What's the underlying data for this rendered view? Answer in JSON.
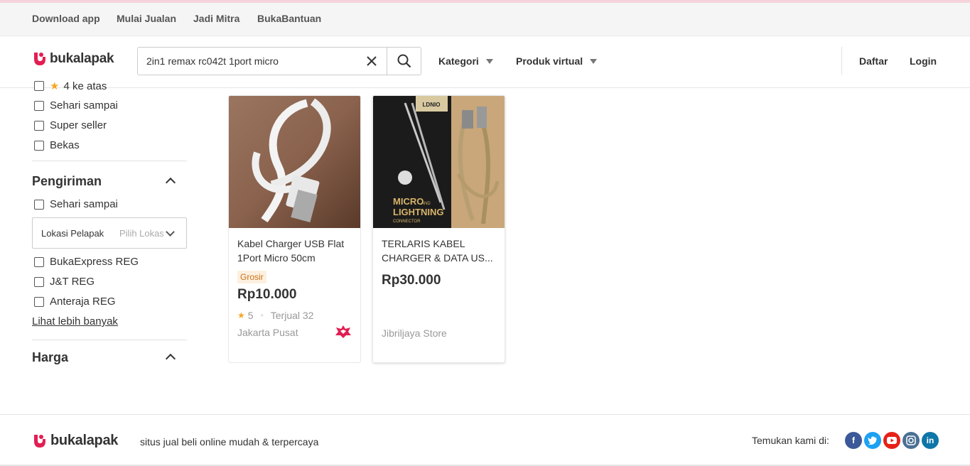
{
  "topbar": {
    "links": [
      "Download app",
      "Mulai Jualan",
      "Jadi Mitra",
      "BukaBantuan"
    ]
  },
  "header": {
    "logo": "bukalapak",
    "search_value": "2in1 remax rc042t 1port micro",
    "nav": [
      "Kategori",
      "Produk virtual"
    ],
    "auth": [
      "Daftar",
      "Login"
    ]
  },
  "sidebar": {
    "rating_partial": "4 ke atas",
    "top_filters": [
      "Sehari sampai",
      "Super seller",
      "Bekas"
    ],
    "shipping_title": "Pengiriman",
    "shipping_same_day": "Sehari sampai",
    "location_label": "Lokasi Pelapak",
    "location_placeholder": "Pilih Lokasi",
    "couriers": [
      "BukaExpress REG",
      "J&T REG",
      "Anteraja REG"
    ],
    "see_more": "Lihat lebih banyak",
    "price_title": "Harga"
  },
  "products": [
    {
      "name": "Kabel Charger USB Flat 1Port Micro 50cm",
      "badge": "Grosir",
      "price": "Rp10.000",
      "rating": "5",
      "sold": "Terjual 32",
      "location": "Jakarta Pusat"
    },
    {
      "name": "TERLARIS KABEL CHARGER & DATA US...",
      "price": "Rp30.000",
      "store": "Jibriljaya Store",
      "image_text": {
        "brand": "LDNIO",
        "line1": "MICRO",
        "and": "AND",
        "line2": "LIGHTNING",
        "line3": "CONNECTOR"
      }
    }
  ],
  "footer": {
    "logo": "bukalapak",
    "tagline": "situs jual beli online mudah & terpercaya",
    "find_us": "Temukan kami di:",
    "social_icons": [
      "facebook-icon",
      "twitter-icon",
      "youtube-icon",
      "instagram-icon",
      "linkedin-icon"
    ]
  },
  "colors": {
    "brand": "#e31e52",
    "star": "#f5a623",
    "badge_bg": "#fdf0e0",
    "badge_text": "#c9731a"
  }
}
